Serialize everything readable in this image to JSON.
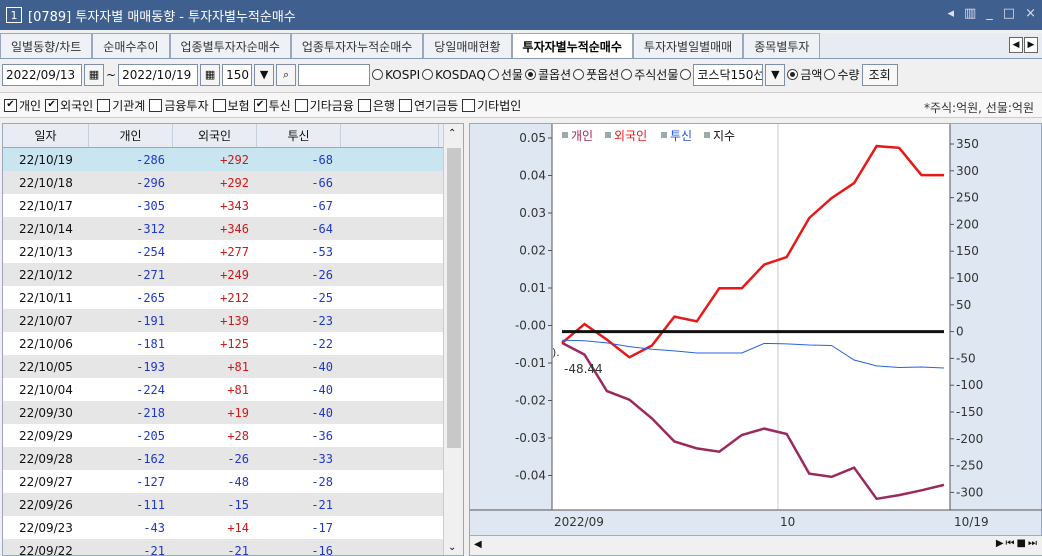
{
  "titlebar": {
    "num": "1",
    "title": "[0789] 투자자별 매매동향 - 투자자별누적순매수",
    "controls": [
      "◂",
      "▥",
      "_",
      "□",
      "×"
    ]
  },
  "tabs": [
    {
      "label": "일별동향/차트",
      "active": false
    },
    {
      "label": "순매수추이",
      "active": false
    },
    {
      "label": "업종별투자자순매수",
      "active": false
    },
    {
      "label": "업종투자자누적순매수",
      "active": false
    },
    {
      "label": "당일매매현황",
      "active": false
    },
    {
      "label": "투자자별누적순매수",
      "active": true
    },
    {
      "label": "투자자별일별매매",
      "active": false
    },
    {
      "label": "종목별투자",
      "active": false
    }
  ],
  "filter": {
    "start_date": "2022/09/13",
    "end_date": "2022/10/19",
    "tilde": "~",
    "count": "150",
    "code_value": "",
    "markets": [
      {
        "label": "KOSPI",
        "selected": false
      },
      {
        "label": "KOSDAQ",
        "selected": false
      },
      {
        "label": "선물",
        "selected": false
      },
      {
        "label": "콜옵션",
        "selected": true
      },
      {
        "label": "풋옵션",
        "selected": false
      },
      {
        "label": "주식선물",
        "selected": false
      }
    ],
    "index_select": "코스닥150선",
    "units": [
      {
        "label": "금액",
        "selected": true
      },
      {
        "label": "수량",
        "selected": false
      }
    ],
    "query_label": "조회"
  },
  "checks": {
    "items": [
      {
        "label": "개인",
        "checked": true
      },
      {
        "label": "외국인",
        "checked": true
      },
      {
        "label": "기관계",
        "checked": false
      },
      {
        "label": "금융투자",
        "checked": false
      },
      {
        "label": "보험",
        "checked": false
      },
      {
        "label": "투신",
        "checked": true
      },
      {
        "label": "기타금융",
        "checked": false
      },
      {
        "label": "은행",
        "checked": false
      },
      {
        "label": "연기금등",
        "checked": false
      },
      {
        "label": "기타법인",
        "checked": false
      }
    ],
    "unit_note": "*주식:억원, 선물:억원"
  },
  "table": {
    "headers": [
      "일자",
      "개인",
      "외국인",
      "투신",
      ""
    ],
    "rows": [
      [
        "22/10/19",
        "-286",
        "+292",
        "-68"
      ],
      [
        "22/10/18",
        "-296",
        "+292",
        "-66"
      ],
      [
        "22/10/17",
        "-305",
        "+343",
        "-67"
      ],
      [
        "22/10/14",
        "-312",
        "+346",
        "-64"
      ],
      [
        "22/10/13",
        "-254",
        "+277",
        "-53"
      ],
      [
        "22/10/12",
        "-271",
        "+249",
        "-26"
      ],
      [
        "22/10/11",
        "-265",
        "+212",
        "-25"
      ],
      [
        "22/10/07",
        "-191",
        "+139",
        "-23"
      ],
      [
        "22/10/06",
        "-181",
        "+125",
        "-22"
      ],
      [
        "22/10/05",
        "-193",
        "+81",
        "-40"
      ],
      [
        "22/10/04",
        "-224",
        "+81",
        "-40"
      ],
      [
        "22/09/30",
        "-218",
        "+19",
        "-40"
      ],
      [
        "22/09/29",
        "-205",
        "+28",
        "-36"
      ],
      [
        "22/09/28",
        "-162",
        "-26",
        "-33"
      ],
      [
        "22/09/27",
        "-127",
        "-48",
        "-28"
      ],
      [
        "22/09/26",
        "-111",
        "-15",
        "-21"
      ],
      [
        "22/09/23",
        "-43",
        "+14",
        "-17"
      ],
      [
        "22/09/22",
        "-21",
        "-21",
        "-16"
      ]
    ]
  },
  "chart": {
    "legend": [
      {
        "label": "개인",
        "color": "#a0285a"
      },
      {
        "label": "외국인",
        "color": "#e81818"
      },
      {
        "label": "투신",
        "color": "#2050d8"
      },
      {
        "label": "지수",
        "color": "#111111"
      }
    ],
    "left_ticks": [
      "0.05",
      "0.04",
      "0.03",
      "0.02",
      "0.01",
      "-0.00",
      "-0.01",
      "-0.02",
      "-0.03",
      "-0.04"
    ],
    "right_ticks": [
      "350",
      "300",
      "250",
      "200",
      "150",
      "100",
      "50",
      "0",
      "-50",
      "-100",
      "-150",
      "-200",
      "-250",
      "-300"
    ],
    "x_labels": [
      "2022/09",
      "10",
      "10/19"
    ],
    "cursor_value": "-48.44",
    "cursor_mark": ")."
  }
}
